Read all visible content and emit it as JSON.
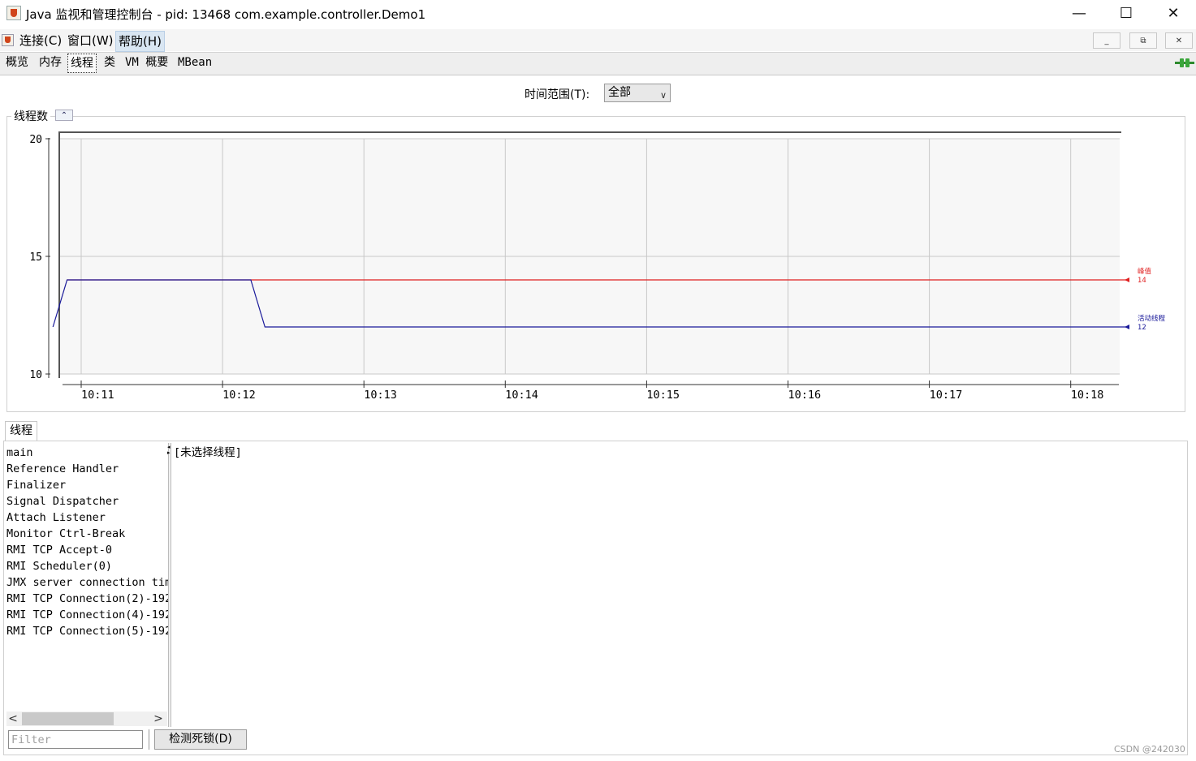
{
  "window": {
    "title": "Java 监视和管理控制台 - pid: 13468 com.example.controller.Demo1",
    "minimize_glyph": "—",
    "maximize_glyph": "☐",
    "close_glyph": "✕"
  },
  "menu": {
    "connect": "连接(C)",
    "window": "窗口(W)",
    "help": "帮助(H)",
    "mdi_minimize": "_",
    "mdi_restore": "⧉",
    "mdi_close": "✕"
  },
  "tabs": [
    {
      "label": "概览"
    },
    {
      "label": "内存"
    },
    {
      "label": "线程"
    },
    {
      "label": "类"
    },
    {
      "label": "VM 概要"
    },
    {
      "label": "MBean"
    }
  ],
  "time_range": {
    "label": "时间范围(T):",
    "selected": "全部"
  },
  "chart_panel": {
    "title": "线程数",
    "collapse_glyph": "⌃"
  },
  "chart_data": {
    "type": "line",
    "title": "线程数",
    "ylim": [
      10,
      20
    ],
    "yticks": [
      "20",
      "15",
      "10"
    ],
    "xticks": [
      "10:11",
      "10:12",
      "10:13",
      "10:14",
      "10:15",
      "10:16",
      "10:17",
      "10:18"
    ],
    "grid": true,
    "series": [
      {
        "name": "峰值",
        "color": "#e02020",
        "value_label": "14",
        "points": [
          [
            "10:10.9",
            14
          ],
          [
            "10:18.4",
            14
          ]
        ]
      },
      {
        "name": "活动线程",
        "color": "#1a1a9a",
        "value_label": "12",
        "points": [
          [
            "10:10.8",
            12
          ],
          [
            "10:10.9",
            14
          ],
          [
            "10:12.2",
            14
          ],
          [
            "10:12.3",
            12
          ],
          [
            "10:18.4",
            12
          ]
        ]
      }
    ]
  },
  "lower": {
    "tab_label": "线程",
    "threads": [
      "main",
      "Reference Handler",
      "Finalizer",
      "Signal Dispatcher",
      "Attach Listener",
      "Monitor Ctrl-Break",
      "RMI TCP Accept-0",
      "RMI Scheduler(0)",
      "JMX server connection tim",
      "RMI TCP Connection(2)-192",
      "RMI TCP Connection(4)-192",
      "RMI TCP Connection(5)-192"
    ],
    "detail_text": "[未选择线程]",
    "filter_placeholder": "Filter",
    "deadlock_button": "检测死锁(D)",
    "scroll_left": "<",
    "scroll_right": ">"
  },
  "watermark": "CSDN @242030"
}
